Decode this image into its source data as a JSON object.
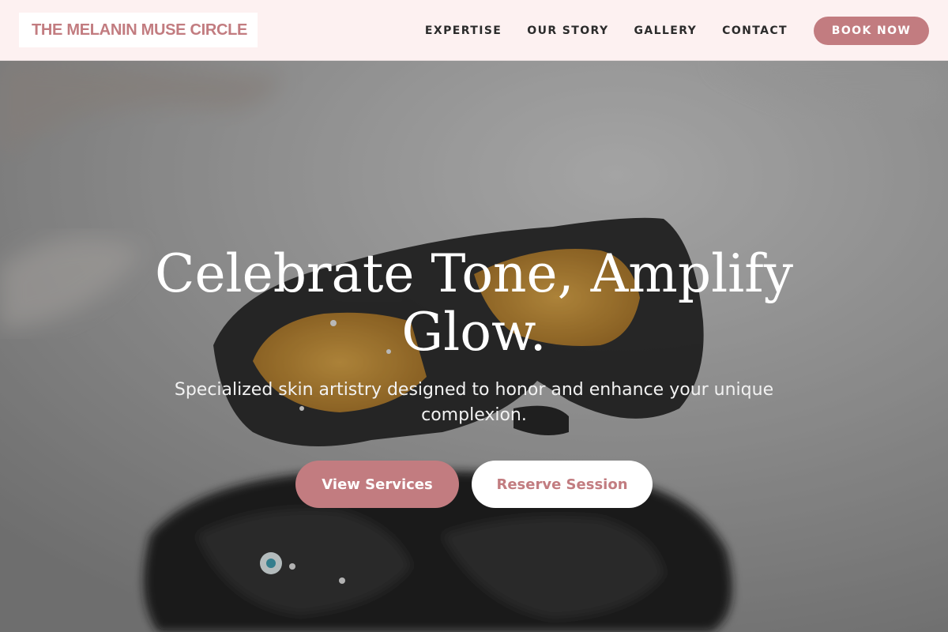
{
  "brand": {
    "logo_text": "THE MELANIN MUSE CIRCLE",
    "accent_color": "#c27c80",
    "header_bg": "#fdf1f1"
  },
  "nav": {
    "items": [
      {
        "label": "EXPERTISE"
      },
      {
        "label": "OUR STORY"
      },
      {
        "label": "GALLERY"
      },
      {
        "label": "CONTACT"
      }
    ],
    "cta_label": "BOOK NOW"
  },
  "hero": {
    "title": "Celebrate Tone, Amplify Glow.",
    "subtitle": "Specialized skin artistry designed to honor and enhance your unique complexion.",
    "primary_button": "View Services",
    "secondary_button": "Reserve Session",
    "image_description_icon": "laser-safety-goggles-photo"
  }
}
